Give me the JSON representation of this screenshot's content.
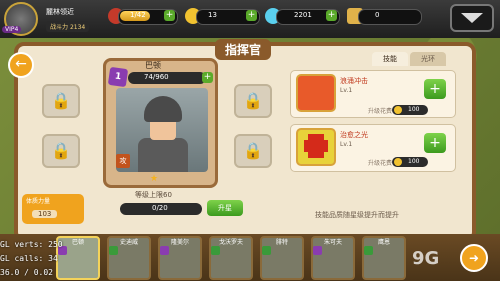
{
  "player": {
    "name": "麓林领近",
    "vip": "VIP4",
    "power_label": "战斗力",
    "power_value": "2134"
  },
  "resources": {
    "stamina": {
      "value": "1/42",
      "fill": 0.55
    },
    "gold": "13",
    "gems": "2201",
    "honor": "0"
  },
  "screen": {
    "title": "指挥官"
  },
  "hero": {
    "name": "巴顿",
    "star_level": "1",
    "shards": "74/960",
    "level_cap": "等级上限60",
    "exp": "0/20",
    "upgrade_label": "升星",
    "stamp": "攻"
  },
  "tabs": [
    "技能",
    "光环"
  ],
  "skills": [
    {
      "name": "浪涌冲击",
      "level": "Lv.1",
      "cost_label": "升级花费",
      "cost": "100",
      "icon": "fist-icon"
    },
    {
      "name": "治愈之光",
      "level": "Lv.1",
      "cost_label": "升级花费",
      "cost": "100",
      "icon": "red-cross-icon"
    }
  ],
  "tip": "技能品质随星级提升而提升",
  "stats": {
    "label": "体质力量",
    "value": "103"
  },
  "roster": [
    {
      "name": "巴顿",
      "selected": true
    },
    {
      "name": "史迪威",
      "selected": false
    },
    {
      "name": "隆美尔",
      "selected": false
    },
    {
      "name": "戈沃罗夫",
      "selected": false
    },
    {
      "name": "腓特",
      "selected": false
    },
    {
      "name": "朱可夫",
      "selected": false
    },
    {
      "name": "鹰恩",
      "selected": false
    }
  ],
  "debug": [
    "GL verts: 250",
    "GL calls: 34",
    "36.0 / 0.02"
  ],
  "watermark": "9G"
}
